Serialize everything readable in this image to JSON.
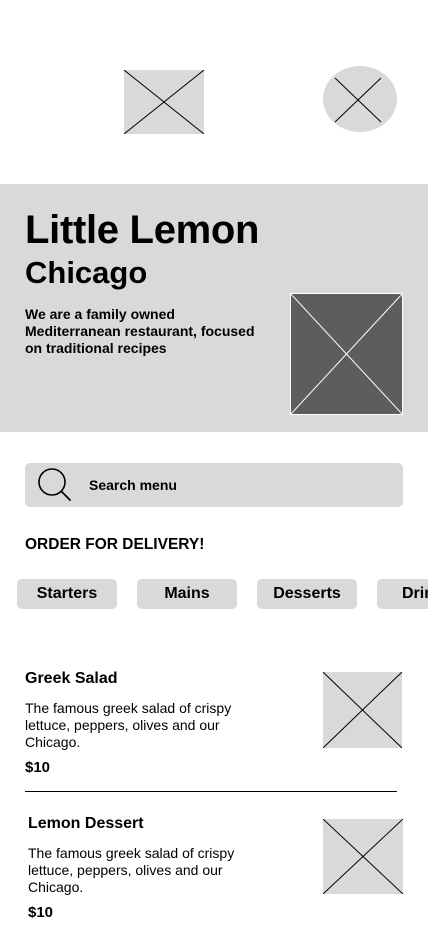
{
  "hero": {
    "title": "Little Lemon",
    "subtitle": "Chicago",
    "description": "We are a family owned Mediterranean restaurant, focused on traditional recipes"
  },
  "search": {
    "placeholder": "Search menu",
    "icon": "search-icon"
  },
  "order": {
    "heading": "ORDER FOR DELIVERY!",
    "categories": [
      "Starters",
      "Mains",
      "Desserts",
      "Drinks"
    ]
  },
  "menu": {
    "items": [
      {
        "name": "Greek Salad",
        "description": "The famous greek salad of crispy lettuce, peppers, olives and our Chicago.",
        "price": "$10"
      },
      {
        "name": "Lemon Dessert",
        "description": "The famous greek salad of crispy lettuce, peppers, olives and our Chicago.",
        "price": "$10"
      }
    ]
  },
  "colors": {
    "placeholder_bg": "#d9d9d9",
    "hero_image_bg": "#5d5d5d"
  }
}
